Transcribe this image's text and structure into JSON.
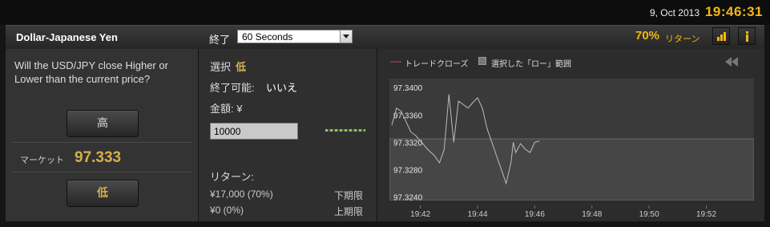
{
  "topbar": {
    "date": "9, Oct 2013",
    "clock": "19:46:31"
  },
  "header": {
    "pair": "Dollar-Japanese Yen",
    "expiry_label": "終了",
    "expiry_value": "60 Seconds",
    "return_pct": "70%",
    "return_label": "リターン"
  },
  "left": {
    "question": "Will the USD/JPY close Higher or Lower than the current price?",
    "high_label": "高",
    "market_label": "マーケット",
    "market_value": "97.333",
    "low_label": "低"
  },
  "mid": {
    "select_label": "選択",
    "select_value": "低",
    "closeable_label": "終了可能:",
    "closeable_value": "いいえ",
    "amount_label": "金額: ¥",
    "amount_value": "10000",
    "return_title": "リターン:",
    "rows": [
      {
        "value": "¥17,000 (70%)",
        "label": "下期限"
      },
      {
        "value": "¥0 (0%)",
        "label": "上期限"
      }
    ]
  },
  "chart_data": {
    "type": "line",
    "legend": [
      "トレードクローズ",
      "選択した「ロー」範囲"
    ],
    "y_ticks": [
      "97.3400",
      "97.3360",
      "97.3320",
      "97.3280",
      "97.3240"
    ],
    "x_ticks": [
      "19:42",
      "19:44",
      "19:46",
      "19:48",
      "19:50",
      "19:52"
    ],
    "ylim": [
      97.3235,
      97.3413
    ],
    "xlim": [
      "19:40:55",
      "19:53:40"
    ],
    "low_range_top": 97.3325,
    "series": [
      {
        "x": [
          "19:41",
          "19:41:10",
          "19:41:20",
          "19:41:30",
          "19:41:40",
          "19:41:50",
          "19:42",
          "19:42:15",
          "19:42:30",
          "19:42:40",
          "19:42:50",
          "19:43:00",
          "19:43:10",
          "19:43:20",
          "19:43:30",
          "19:43:40",
          "19:43:50",
          "19:44:00",
          "19:44:10",
          "19:44:20",
          "19:44:30",
          "19:44:40",
          "19:44:50",
          "19:45:00",
          "19:45:10",
          "19:45:15",
          "19:45:20",
          "19:45:30",
          "19:45:40",
          "19:45:50",
          "19:46:00",
          "19:46:10"
        ],
        "y": [
          97.3345,
          97.337,
          97.3365,
          97.335,
          97.3335,
          97.333,
          97.3322,
          97.331,
          97.33,
          97.329,
          97.331,
          97.339,
          97.332,
          97.338,
          97.3375,
          97.337,
          97.3378,
          97.3385,
          97.337,
          97.334,
          97.332,
          97.33,
          97.328,
          97.326,
          97.329,
          97.332,
          97.3305,
          97.3318,
          97.331,
          97.3305,
          97.332,
          97.3322
        ]
      }
    ]
  }
}
